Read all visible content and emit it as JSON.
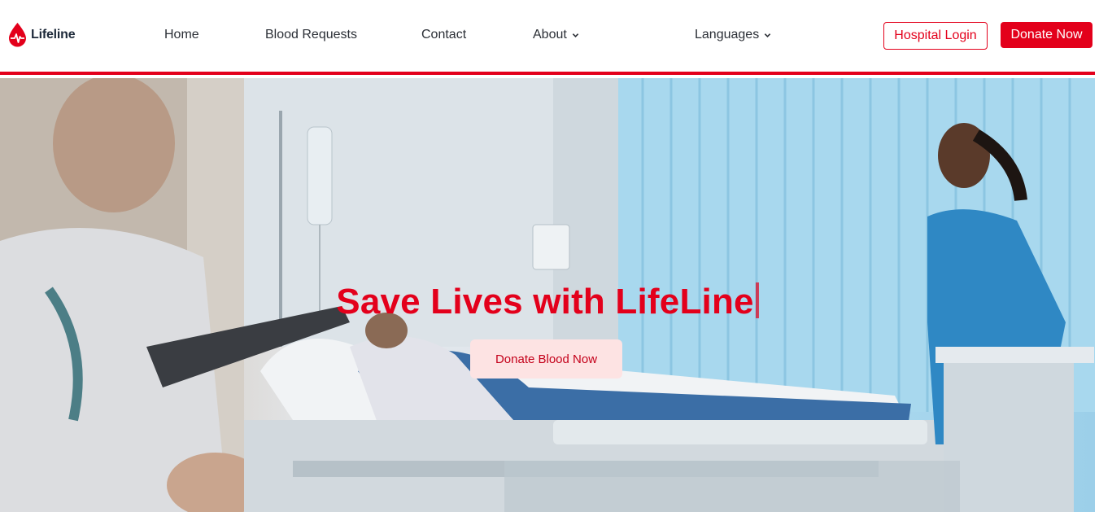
{
  "brand": {
    "name": "Lifeline",
    "logo_icon": "blood-drop-pulse-icon",
    "accent_color": "#e3001b"
  },
  "nav": {
    "home": "Home",
    "blood_requests": "Blood Requests",
    "contact": "Contact",
    "about": "About",
    "languages": "Languages"
  },
  "actions": {
    "hospital_login": "Hospital Login",
    "donate_now": "Donate Now"
  },
  "hero": {
    "title": "Save Lives with LifeLine",
    "cta": "Donate Blood Now",
    "background": "hospital-ward-photo"
  }
}
